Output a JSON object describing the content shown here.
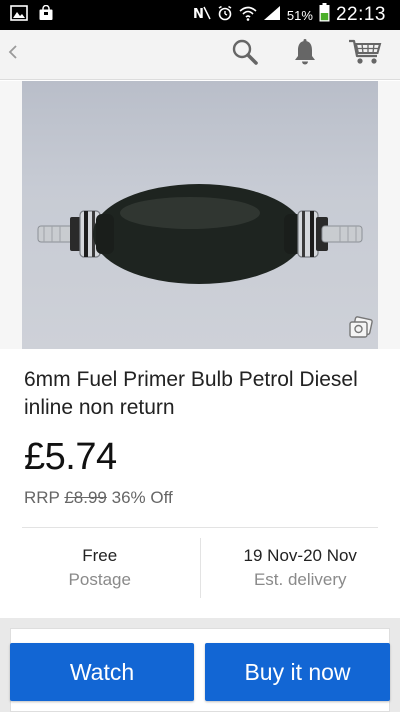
{
  "status_bar": {
    "battery": "51%",
    "time": "22:13"
  },
  "header": {
    "back_icon": "chevron-left-icon",
    "icons": [
      "search-icon",
      "bell-icon",
      "cart-icon"
    ]
  },
  "listing": {
    "title": "6mm Fuel Primer Bulb Petrol Diesel inline non return",
    "price": "£5.74",
    "rrp_label": "RRP",
    "rrp_price": "£8.99",
    "discount": "36% Off"
  },
  "postage": {
    "value": "Free",
    "label": "Postage"
  },
  "delivery": {
    "value": "19 Nov-20 Nov",
    "label": "Est. delivery"
  },
  "actions": {
    "watch_label": "Watch",
    "buy_label": "Buy it now"
  },
  "colors": {
    "button_blue": "#1266d4",
    "status_bar": "#000000",
    "header_bg": "#f3f3f3",
    "battery_green": "#4caf2a"
  }
}
